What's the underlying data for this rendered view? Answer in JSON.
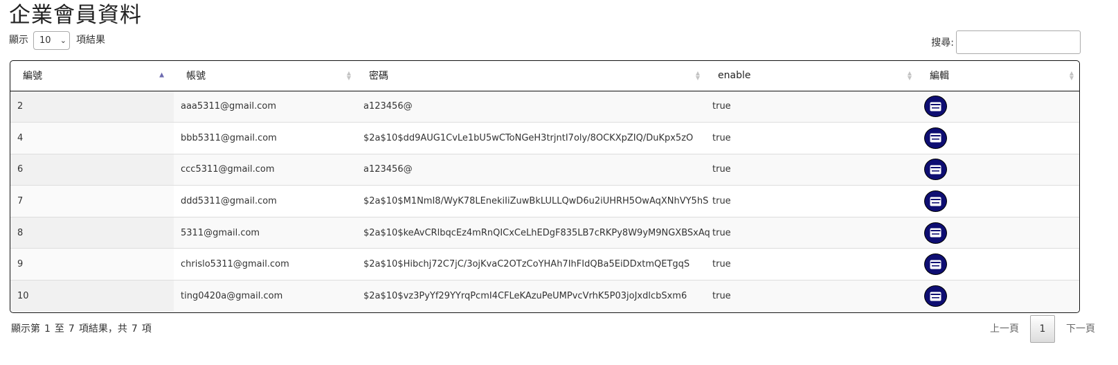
{
  "page": {
    "title": "企業會員資料"
  },
  "length_menu": {
    "prefix": "顯示",
    "value": "10",
    "suffix": "項結果"
  },
  "search": {
    "label": "搜尋:",
    "value": ""
  },
  "table": {
    "columns": [
      "編號",
      "帳號",
      "密碼",
      "enable",
      "編輯"
    ],
    "sorted_column": "編號",
    "sort_direction": "ascending",
    "rows": [
      {
        "id": "2",
        "account": "aaa5311@gmail.com",
        "password": "a123456@",
        "enable": "true"
      },
      {
        "id": "4",
        "account": "bbb5311@gmail.com",
        "password": "$2a$10$dd9AUG1CvLe1bU5wCToNGeH3trjntI7oly/8OCKXpZIQ/DuKpx5zO",
        "enable": "true"
      },
      {
        "id": "6",
        "account": "ccc5311@gmail.com",
        "password": "a123456@",
        "enable": "true"
      },
      {
        "id": "7",
        "account": "ddd5311@gmail.com",
        "password": "$2a$10$M1NmI8/WyK78LEnekiIiZuwBkLULLQwD6u2iUHRH5OwAqXNhVY5hS",
        "enable": "true"
      },
      {
        "id": "8",
        "account": "5311@gmail.com",
        "password": "$2a$10$keAvCRlbqcEz4mRnQICxCeLhEDgF835LB7cRKPy8W9yM9NGXBSxAq",
        "enable": "true"
      },
      {
        "id": "9",
        "account": "chrislo5311@gmail.com",
        "password": "$2a$10$Hibchj72C7jC/3ojKvaC2OTzCoYHAh7IhFIdQBa5EiDDxtmQETgqS",
        "enable": "true"
      },
      {
        "id": "10",
        "account": "ting0420a@gmail.com",
        "password": "$2a$10$vz3PyYf29YYrqPcmI4CFLeKAzuPeUMPvcVrhK5P03joJxdlcbSxm6",
        "enable": "true"
      }
    ],
    "edit_icon": "card-icon",
    "button_color": "#0e0e72"
  },
  "footer": {
    "info_prefix": "顯示第",
    "start": "1",
    "to": "至",
    "end": "7",
    "info_mid": "項結果，共",
    "total": "7",
    "info_suffix": "項"
  },
  "pagination": {
    "previous": "上一頁",
    "current": "1",
    "next": "下一頁"
  }
}
